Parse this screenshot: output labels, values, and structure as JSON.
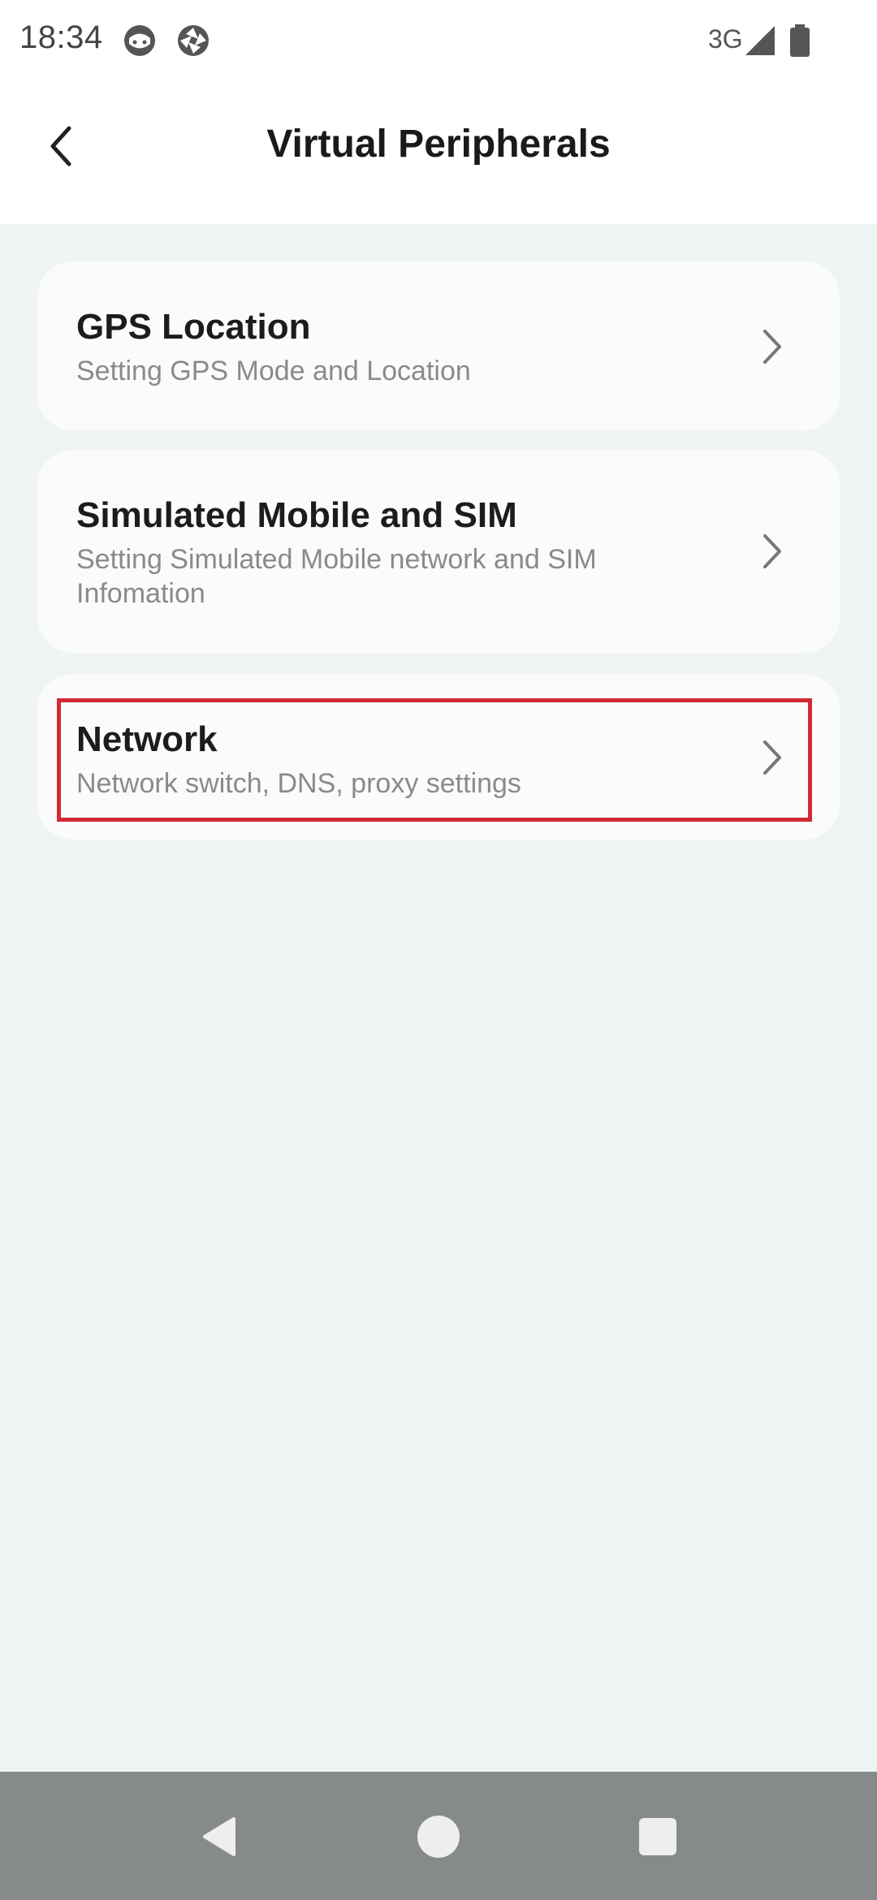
{
  "status_bar": {
    "time": "18:34",
    "network_type": "3G",
    "icons": [
      "face-icon",
      "shutter-icon",
      "signal-icon",
      "battery-icon"
    ]
  },
  "header": {
    "title": "Virtual Peripherals",
    "back_icon": "chevron-left-icon"
  },
  "items": [
    {
      "title": "GPS Location",
      "subtitle": "Setting GPS Mode and Location"
    },
    {
      "title": "Simulated Mobile and SIM",
      "subtitle": "Setting Simulated Mobile network and SIM Infomation"
    },
    {
      "title": "Network",
      "subtitle": "Network switch, DNS, proxy settings",
      "highlighted": true
    }
  ],
  "nav_bar": {
    "buttons": [
      "back-triangle-icon",
      "home-circle-icon",
      "recents-square-icon"
    ]
  },
  "colors": {
    "background": "#eff4f4",
    "card": "#fbfbfb",
    "highlight_border": "#d22a35",
    "nav_bar": "#868a8b"
  }
}
